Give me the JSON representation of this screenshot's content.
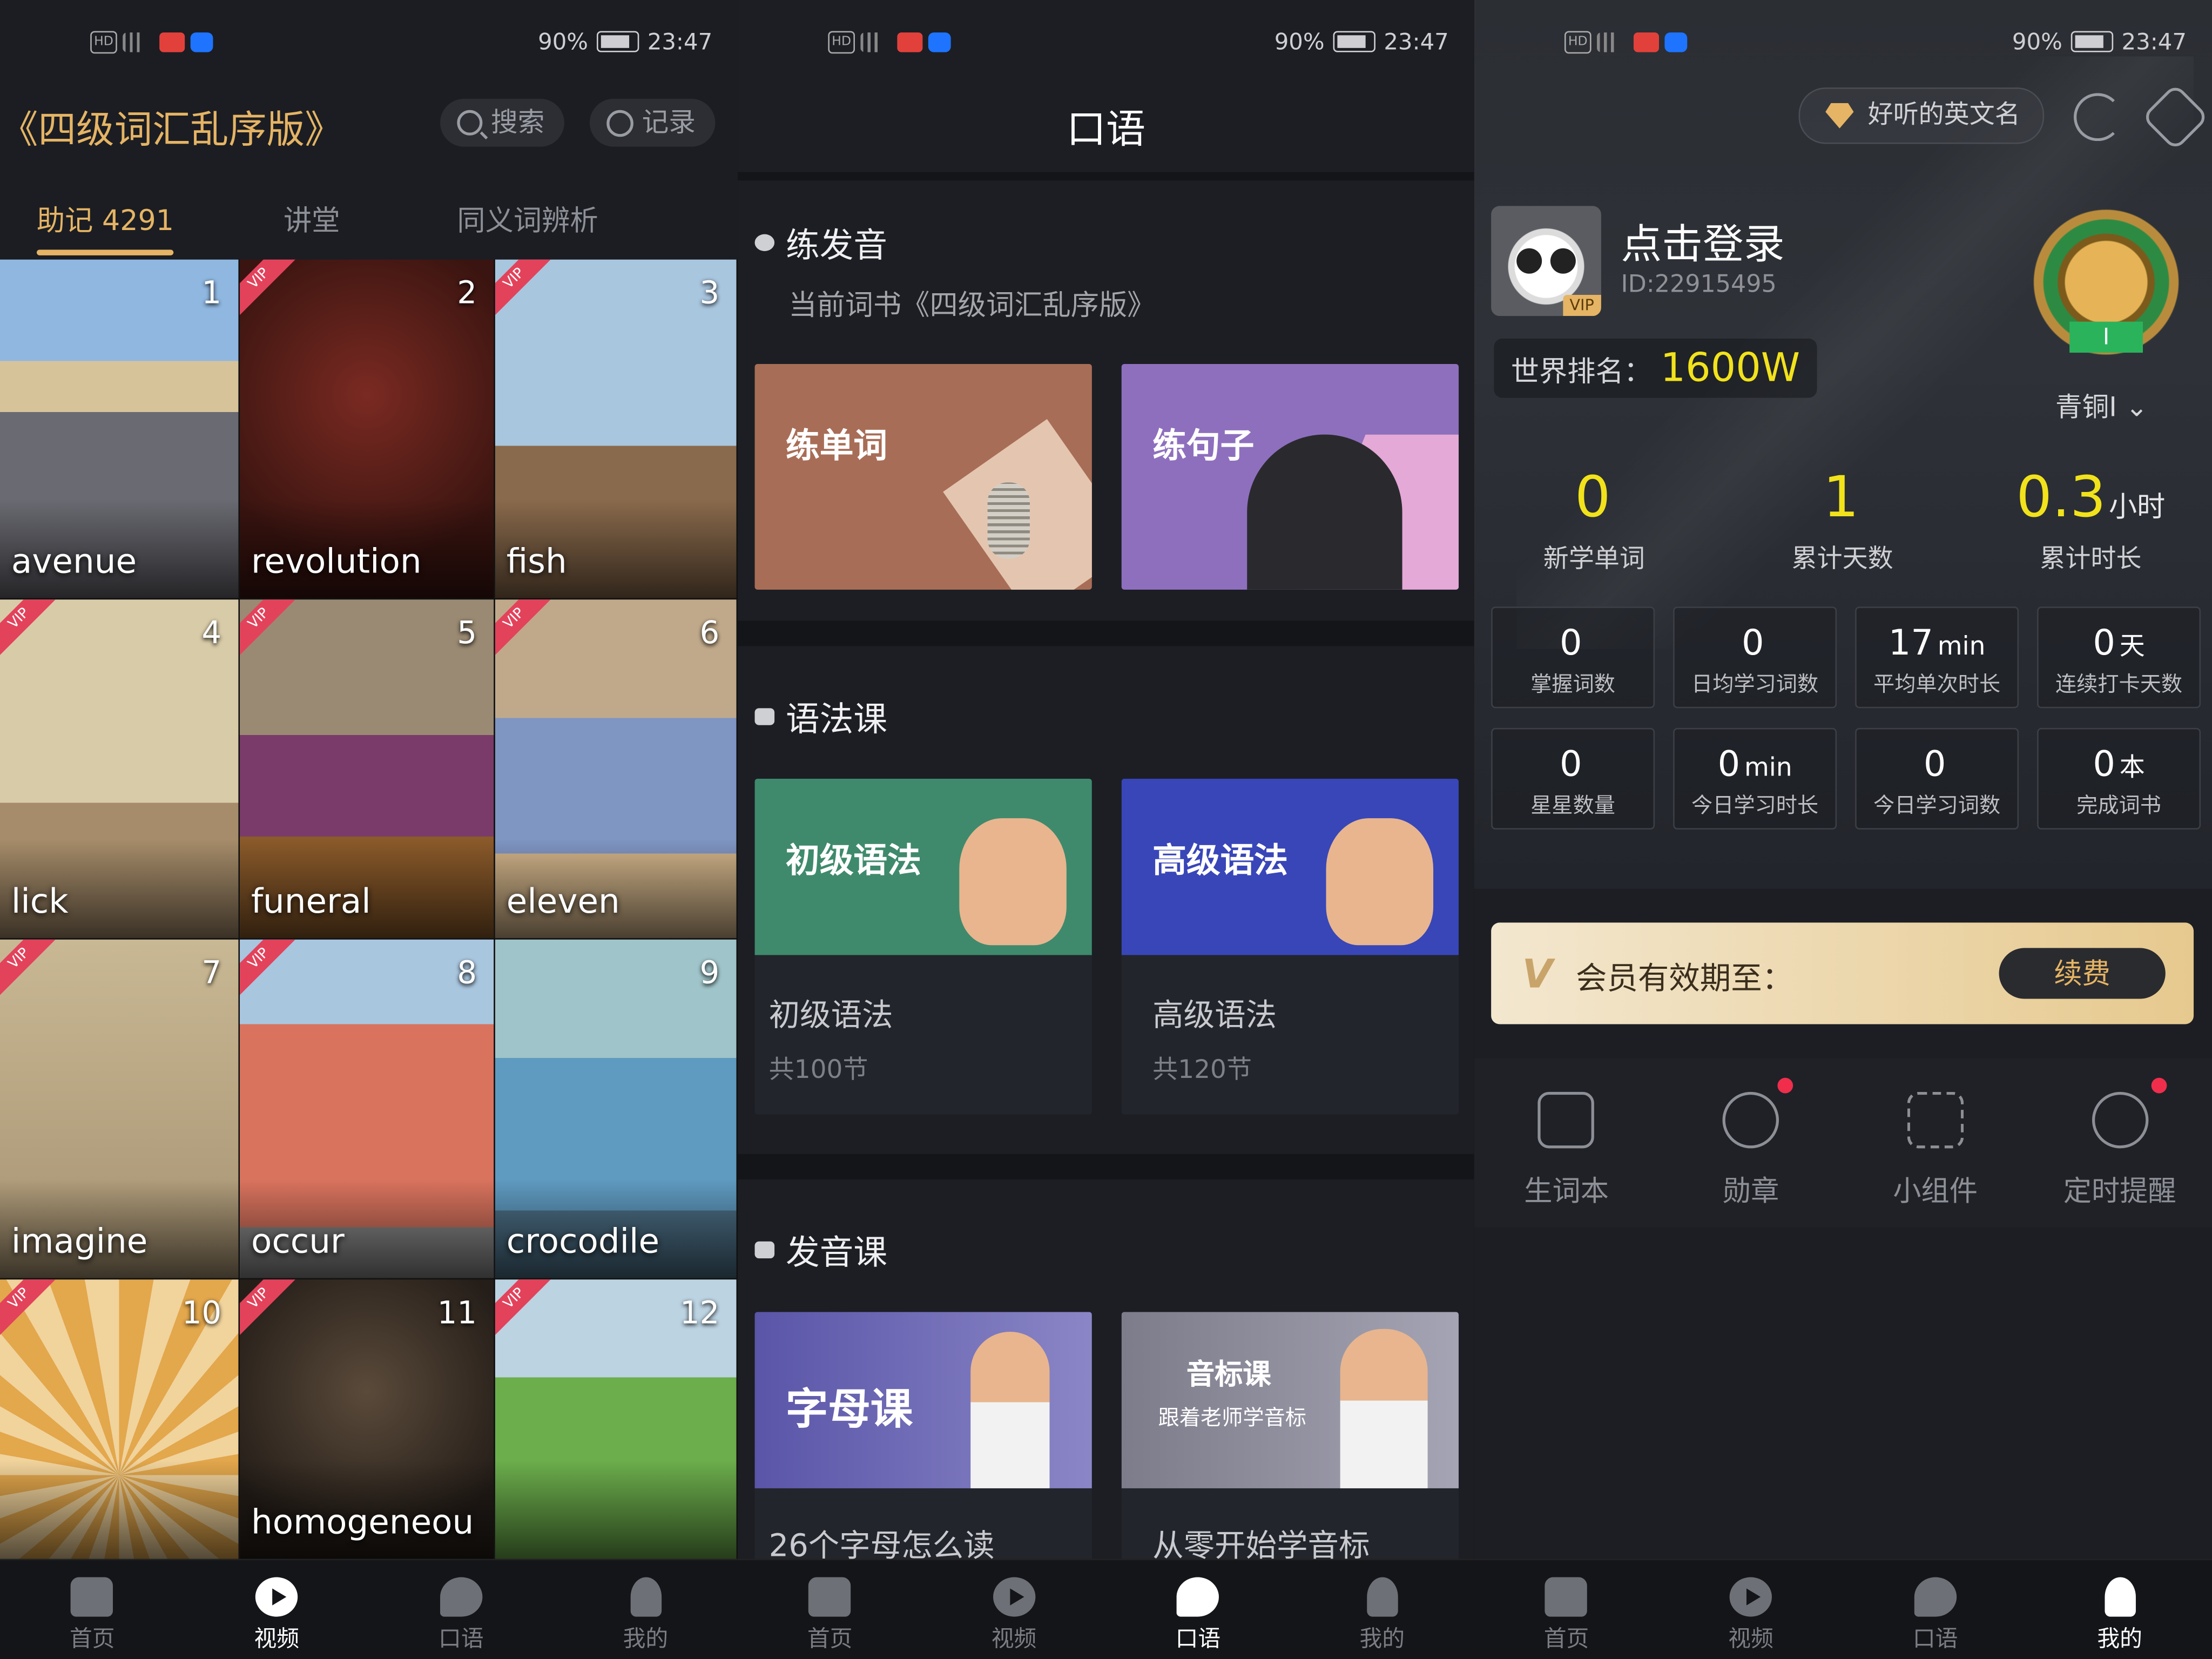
{
  "status": {
    "battery": "90%",
    "time": "23:47"
  },
  "nav": [
    "首页",
    "视频",
    "口语",
    "我的"
  ],
  "p1": {
    "book_title": "《四级词汇乱序版》",
    "search": "搜索",
    "record": "记录",
    "tabs": [
      "助记 4291",
      "讲堂",
      "同义词辨析"
    ],
    "cards": [
      {
        "num": "1",
        "word": "avenue",
        "vip": ""
      },
      {
        "num": "2",
        "word": "revolution",
        "vip": "VIP"
      },
      {
        "num": "3",
        "word": "fish",
        "vip": "VIP"
      },
      {
        "num": "4",
        "word": "lick",
        "vip": "VIP"
      },
      {
        "num": "5",
        "word": "funeral",
        "vip": "VIP"
      },
      {
        "num": "6",
        "word": "eleven",
        "vip": "VIP"
      },
      {
        "num": "7",
        "word": "imagine",
        "vip": "VIP"
      },
      {
        "num": "8",
        "word": "occur",
        "vip": "VIP"
      },
      {
        "num": "9",
        "word": "crocodile",
        "vip": ""
      },
      {
        "num": "10",
        "word": "",
        "vip": "VIP"
      },
      {
        "num": "11",
        "word": "homogeneou",
        "vip": "VIP"
      },
      {
        "num": "12",
        "word": "",
        "vip": "VIP"
      }
    ],
    "active_nav": "视频"
  },
  "p2": {
    "title": "口语",
    "pron_section": "练发音",
    "current_book": "当前词书《四级词汇乱序版》",
    "practice_word": "练单词",
    "practice_sentence": "练句子",
    "grammar_section": "语法课",
    "grammar": [
      {
        "label": "初级语法",
        "name": "初级语法",
        "count": "共100节"
      },
      {
        "label": "高级语法",
        "name": "高级语法",
        "count": "共120节"
      }
    ],
    "phonetic_section": "发音课",
    "letters_label": "字母课",
    "phonetic_label": "音标课",
    "phonetic_sub": "跟着老师学音标",
    "letters_desc": "26个字母怎么读",
    "phonetic_desc": "从零开始学音标",
    "active_nav": "口语"
  },
  "p3": {
    "english_name": "好听的英文名",
    "avatar_badge": "VIP",
    "login": "点击登录",
    "id": "ID:22915495",
    "rank_label": "世界排名：",
    "rank_value": "1600W",
    "tier": "青铜I",
    "medal_level": "I",
    "stats": [
      {
        "value": "0",
        "unit": "",
        "label": "新学单词"
      },
      {
        "value": "1",
        "unit": "",
        "label": "累计天数"
      },
      {
        "value": "0.3",
        "unit": "小时",
        "label": "累计时长"
      }
    ],
    "boxes": [
      {
        "value": "0",
        "unit": "",
        "label": "掌握词数"
      },
      {
        "value": "0",
        "unit": "",
        "label": "日均学习词数"
      },
      {
        "value": "17",
        "unit": "min",
        "label": "平均单次时长"
      },
      {
        "value": "0",
        "unit": "天",
        "label": "连续打卡天数"
      },
      {
        "value": "0",
        "unit": "",
        "label": "星星数量"
      },
      {
        "value": "0",
        "unit": "min",
        "label": "今日学习时长"
      },
      {
        "value": "0",
        "unit": "",
        "label": "今日学习词数"
      },
      {
        "value": "0",
        "unit": "本",
        "label": "完成词书"
      }
    ],
    "vip_text": "会员有效期至：",
    "renew": "续费",
    "tools": [
      "生词本",
      "勋章",
      "小组件",
      "定时提醒"
    ],
    "active_nav": "我的"
  }
}
